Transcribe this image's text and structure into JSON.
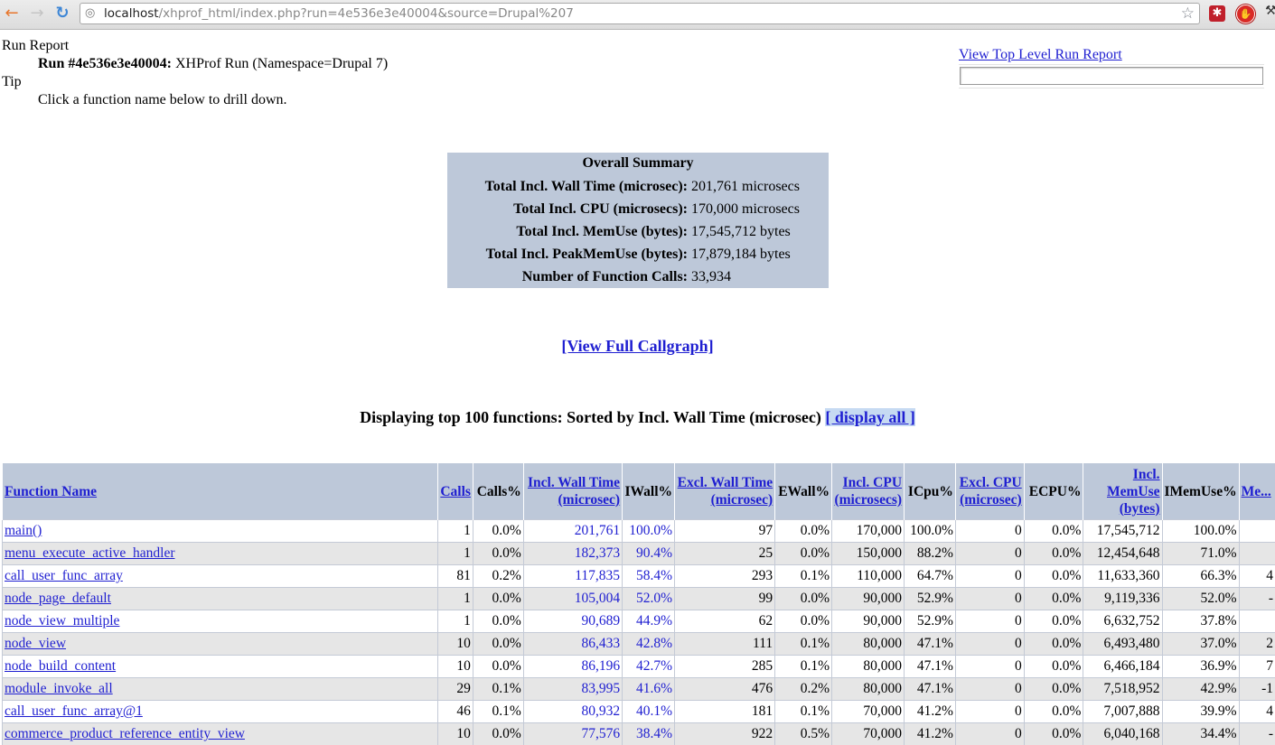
{
  "browser": {
    "url_host": "localhost",
    "url_path": "/xhprof_html/index.php?run=4e536e3e40004&source=Drupal%207",
    "icons": [
      "back-arrow-icon",
      "forward-arrow-icon",
      "reload-icon",
      "globe-icon",
      "bookmark-star-icon",
      "lastpass-extension-icon",
      "adblock-extension-icon",
      "wrench-menu-icon"
    ]
  },
  "header": {
    "run_report_label": "Run Report",
    "run_id_label": "Run #4e536e3e40004:",
    "run_description": "XHProf Run (Namespace=Drupal 7)",
    "tip_label": "Tip",
    "tip_text": "Click a function name below to drill down.",
    "top_level_link": "View Top Level Run Report",
    "search_value": ""
  },
  "summary": {
    "title": "Overall Summary",
    "rows": [
      {
        "label": "Total Incl. Wall Time (microsec):",
        "value": "201,761 microsecs"
      },
      {
        "label": "Total Incl. CPU (microsecs):",
        "value": "170,000 microsecs"
      },
      {
        "label": "Total Incl. MemUse (bytes):",
        "value": "17,545,712 bytes"
      },
      {
        "label": "Total Incl. PeakMemUse (bytes):",
        "value": "17,879,184 bytes"
      },
      {
        "label": "Number of Function Calls:",
        "value": "33,934"
      }
    ]
  },
  "callgraph_link": "[View Full Callgraph]",
  "listing": {
    "heading": "Displaying top 100 functions: Sorted by Incl. Wall Time (microsec)",
    "display_all_link": "[ display all ]"
  },
  "table": {
    "columns": [
      {
        "label": "Function Name",
        "link": true
      },
      {
        "label": "Calls",
        "link": true
      },
      {
        "label": "Calls%",
        "link": false
      },
      {
        "label": "Incl. Wall Time (microsec)",
        "link": true
      },
      {
        "label": "IWall%",
        "link": false
      },
      {
        "label": "Excl. Wall Time (microsec)",
        "link": true
      },
      {
        "label": "EWall%",
        "link": false
      },
      {
        "label": "Incl. CPU (microsecs)",
        "link": true
      },
      {
        "label": "ICpu%",
        "link": false
      },
      {
        "label": "Excl. CPU (microsec)",
        "link": true
      },
      {
        "label": "ECPU%",
        "link": false
      },
      {
        "label": "Incl. MemUse (bytes)",
        "link": true
      },
      {
        "label": "IMemUse%",
        "link": false
      },
      {
        "label": "Me...",
        "link": true
      }
    ],
    "rows": [
      [
        "main()",
        "1",
        "0.0%",
        "201,761",
        "100.0%",
        "97",
        "0.0%",
        "170,000",
        "100.0%",
        "0",
        "0.0%",
        "17,545,712",
        "100.0%",
        ""
      ],
      [
        "menu_execute_active_handler",
        "1",
        "0.0%",
        "182,373",
        "90.4%",
        "25",
        "0.0%",
        "150,000",
        "88.2%",
        "0",
        "0.0%",
        "12,454,648",
        "71.0%",
        ""
      ],
      [
        "call_user_func_array",
        "81",
        "0.2%",
        "117,835",
        "58.4%",
        "293",
        "0.1%",
        "110,000",
        "64.7%",
        "0",
        "0.0%",
        "11,633,360",
        "66.3%",
        "4"
      ],
      [
        "node_page_default",
        "1",
        "0.0%",
        "105,004",
        "52.0%",
        "99",
        "0.0%",
        "90,000",
        "52.9%",
        "0",
        "0.0%",
        "9,119,336",
        "52.0%",
        "-"
      ],
      [
        "node_view_multiple",
        "1",
        "0.0%",
        "90,689",
        "44.9%",
        "62",
        "0.0%",
        "90,000",
        "52.9%",
        "0",
        "0.0%",
        "6,632,752",
        "37.8%",
        ""
      ],
      [
        "node_view",
        "10",
        "0.0%",
        "86,433",
        "42.8%",
        "111",
        "0.1%",
        "80,000",
        "47.1%",
        "0",
        "0.0%",
        "6,493,480",
        "37.0%",
        "2"
      ],
      [
        "node_build_content",
        "10",
        "0.0%",
        "86,196",
        "42.7%",
        "285",
        "0.1%",
        "80,000",
        "47.1%",
        "0",
        "0.0%",
        "6,466,184",
        "36.9%",
        "7"
      ],
      [
        "module_invoke_all",
        "29",
        "0.1%",
        "83,995",
        "41.6%",
        "476",
        "0.2%",
        "80,000",
        "47.1%",
        "0",
        "0.0%",
        "7,518,952",
        "42.9%",
        "-1"
      ],
      [
        "call_user_func_array@1",
        "46",
        "0.1%",
        "80,932",
        "40.1%",
        "181",
        "0.1%",
        "70,000",
        "41.2%",
        "0",
        "0.0%",
        "7,007,888",
        "39.9%",
        "4"
      ],
      [
        "commerce_product_reference_entity_view",
        "10",
        "0.0%",
        "77,576",
        "38.4%",
        "922",
        "0.5%",
        "70,000",
        "41.2%",
        "0",
        "0.0%",
        "6,040,168",
        "34.4%",
        "-"
      ]
    ]
  }
}
